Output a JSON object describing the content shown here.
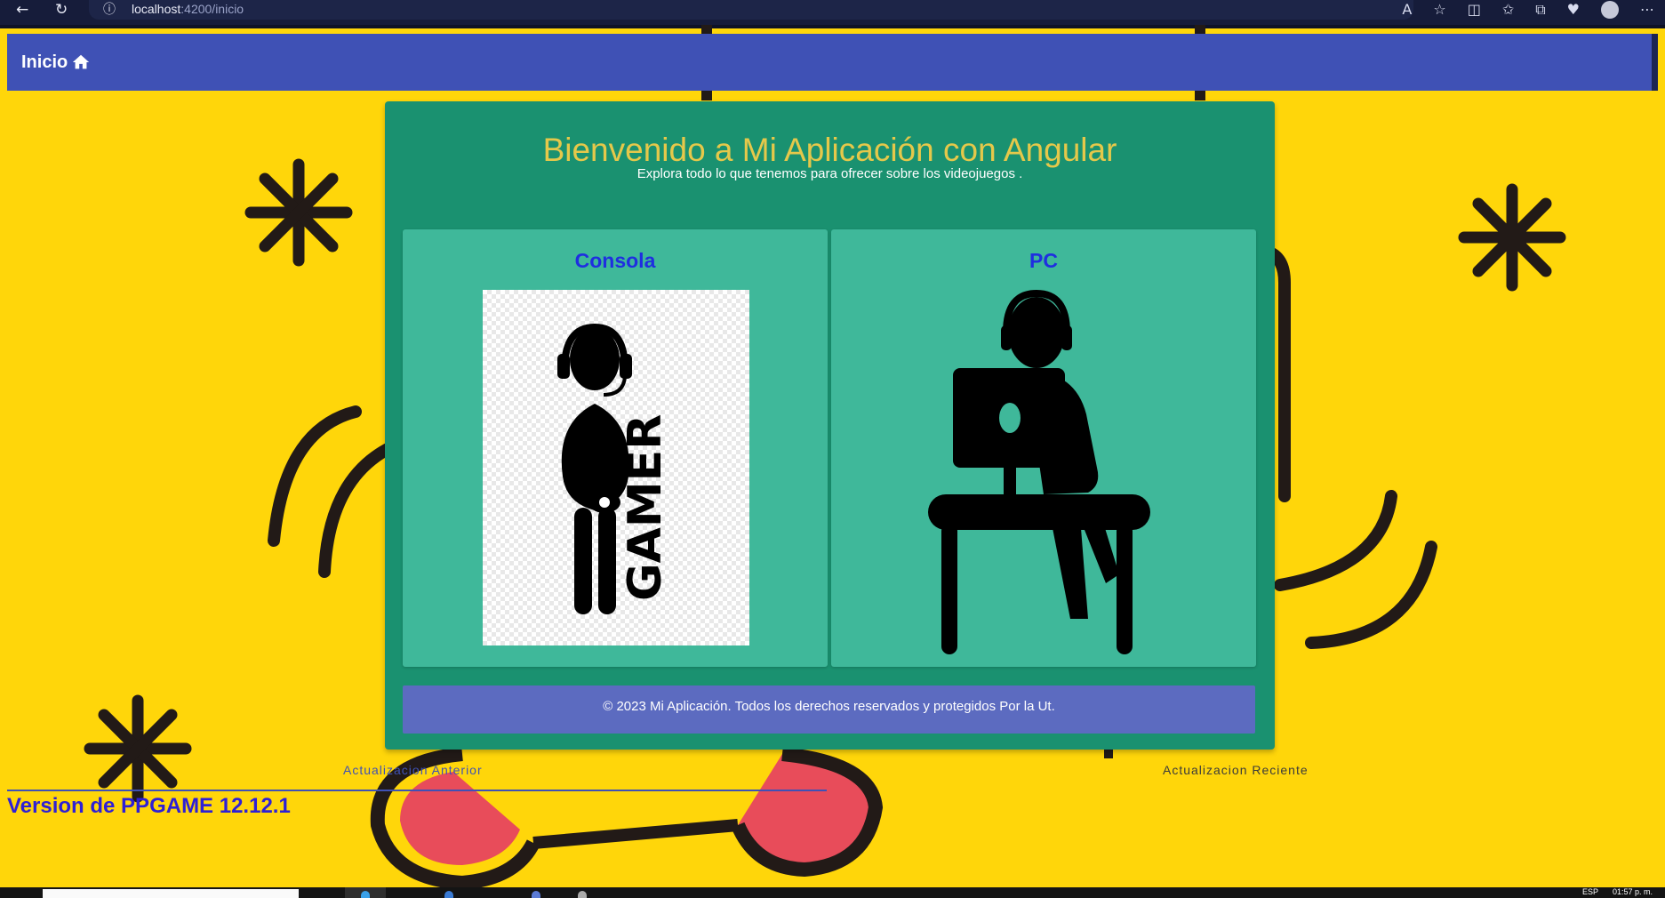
{
  "browser": {
    "url_host": "localhost",
    "url_path": ":4200/inicio",
    "back_icon": "back-arrow-icon",
    "refresh_icon": "refresh-icon",
    "info_icon": "site-info-icon"
  },
  "toolbar": {
    "home_label": "Inicio",
    "home_icon": "home-icon",
    "color": "#3f51b5"
  },
  "main": {
    "title": "Bienvenido a Mi Aplicación con Angular",
    "subtitle": "Explora todo lo que tenemos para ofrecer sobre los videojuegos .",
    "cards": [
      {
        "title": "Consola",
        "image_text": "GAMER"
      },
      {
        "title": "PC"
      }
    ],
    "footer": "© 2023 Mi Aplicación. Todos los derechos reservados y protegidos Por la Ut."
  },
  "tabs": {
    "previous": "Actualizacion Anterior",
    "recent": "Actualizacion Reciente",
    "active": "previous"
  },
  "version": "Version de PPGAME 12.12.1",
  "taskbar": {
    "lang": "ESP",
    "time": "01:57 p. m."
  },
  "colors": {
    "page_background": "#ffd60a",
    "card": "#1a9170",
    "option_card": "#3fb89a",
    "title": "#e5c84a",
    "footer": "#5c6bc0",
    "link": "#1f2ee0"
  }
}
